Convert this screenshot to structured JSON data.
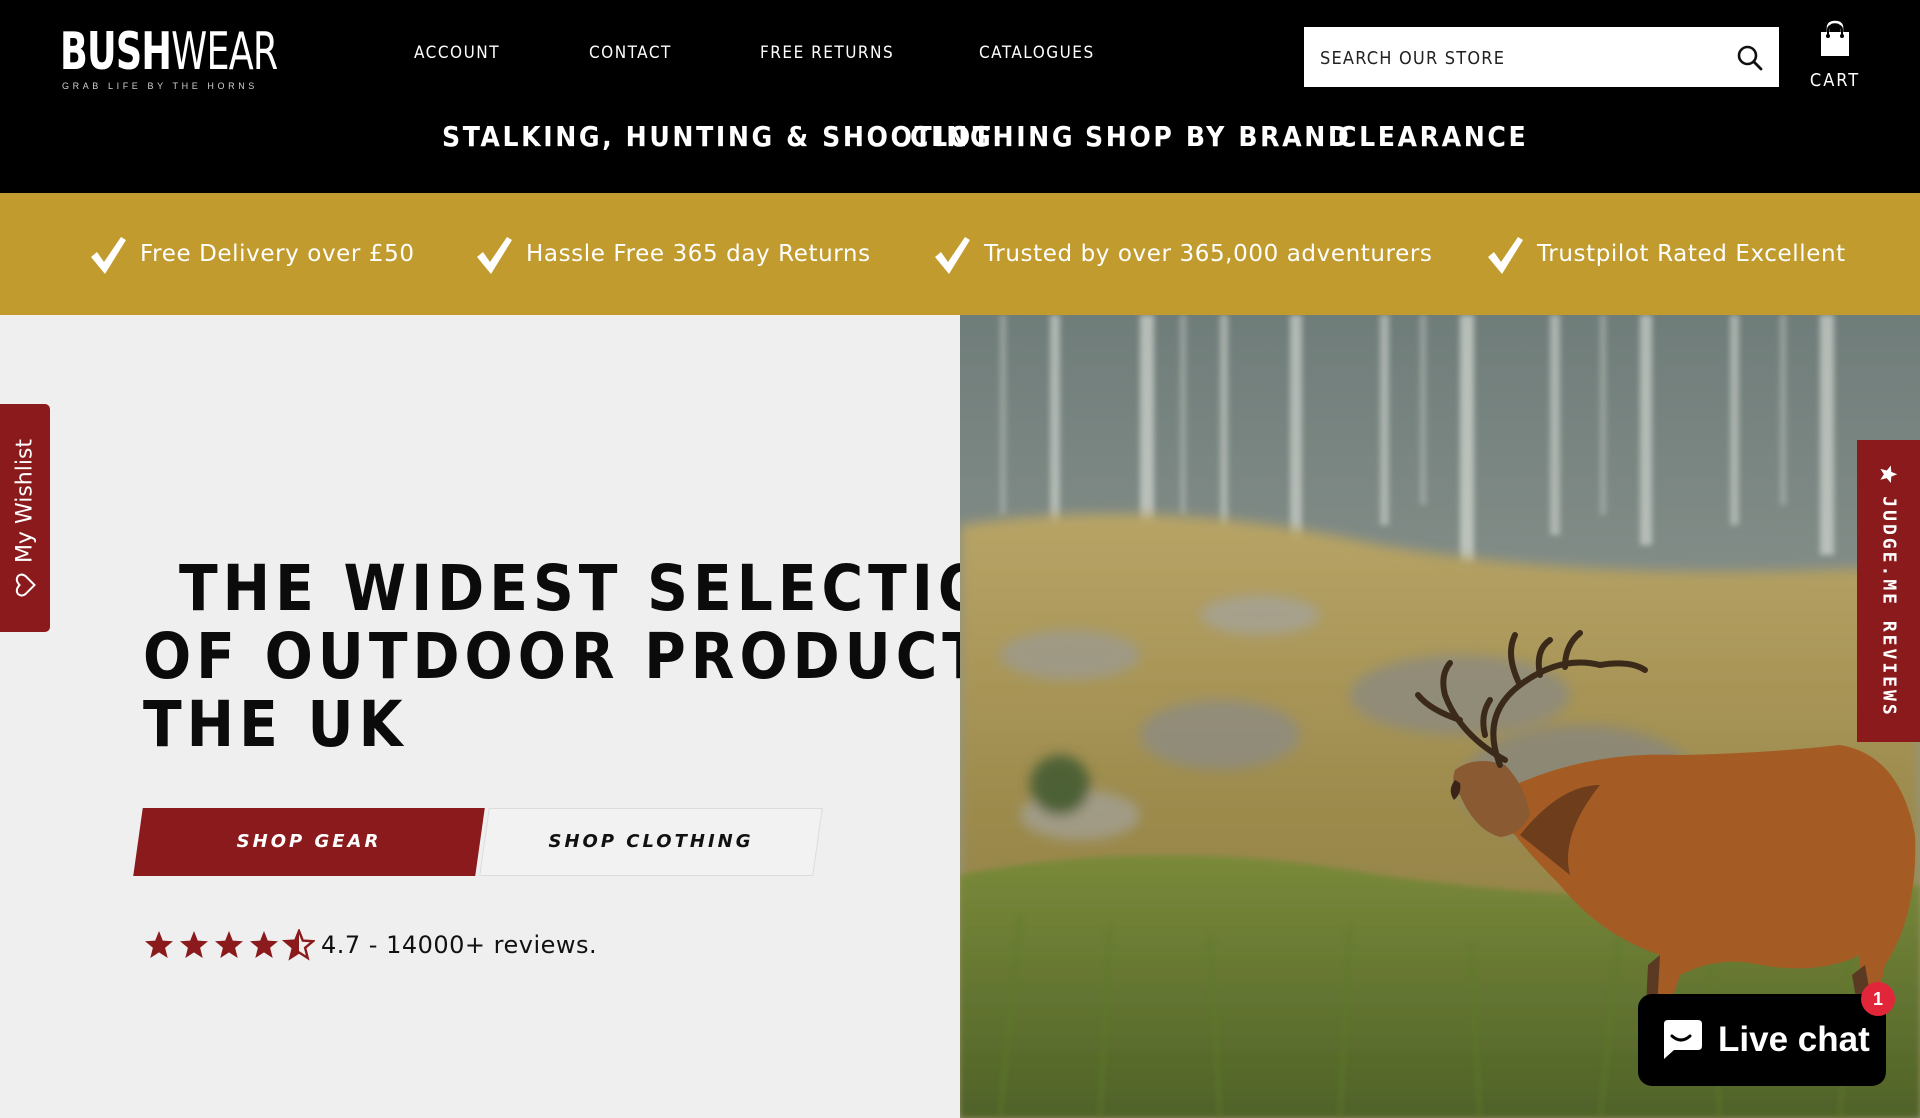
{
  "brand": {
    "name_bold": "BUSH",
    "name_light": "WEAR",
    "tagline": "GRAB LIFE BY THE HORNS"
  },
  "utility_nav": [
    "ACCOUNT",
    "CONTACT",
    "FREE RETURNS",
    "CATALOGUES"
  ],
  "search": {
    "placeholder": "SEARCH OUR STORE",
    "icon": "search-icon"
  },
  "cart": {
    "label": "CART",
    "icon": "shopping-bag-icon"
  },
  "main_nav": [
    "STALKING, HUNTING & SHOOTING",
    "CLOTHING",
    "SHOP BY BRAND",
    "CLEARANCE"
  ],
  "usp_bar": {
    "color": "#c19b2d",
    "items": [
      "Free Delivery over £50",
      "Hassle Free 365 day Returns",
      "Trusted by over 365,000 adventurers",
      "Trustpilot Rated Excellent"
    ],
    "icon": "checkmark-icon"
  },
  "hero": {
    "title_lines": [
      "THE WIDEST SELECTION",
      "OF OUTDOOR PRODUCTS IN",
      "THE UK"
    ],
    "primary_button": "SHOP GEAR",
    "secondary_button": "SHOP CLOTHING",
    "rating": {
      "stars": 4.7,
      "text": "4.7 - 14000+ reviews."
    },
    "accent": "#8b1a1c",
    "image": "red-deer-stag-roaring-in-highland-landscape"
  },
  "wishlist_tab": {
    "label": "My Wishlist",
    "icon": "heart-icon"
  },
  "reviews_tab": {
    "label": "JUDGE.ME REVIEWS",
    "icon": "star-icon"
  },
  "live_chat": {
    "label": "Live chat",
    "badge": "1",
    "icon": "chat-bubble-icon"
  }
}
